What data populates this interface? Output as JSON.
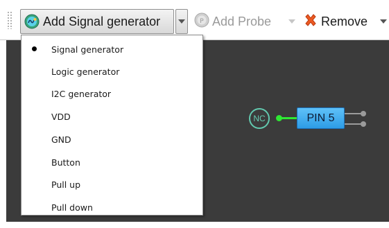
{
  "toolbar": {
    "add_signal_label": "Add Signal generator",
    "add_probe_label": "Add Probe",
    "remove_label": "Remove"
  },
  "menu": {
    "items": [
      {
        "label": "Signal generator",
        "selected": true
      },
      {
        "label": "Logic generator",
        "selected": false
      },
      {
        "label": "I2C generator",
        "selected": false
      },
      {
        "label": "VDD",
        "selected": false
      },
      {
        "label": "GND",
        "selected": false
      },
      {
        "label": "Button",
        "selected": false
      },
      {
        "label": "Pull up",
        "selected": false
      },
      {
        "label": "Pull down",
        "selected": false
      }
    ]
  },
  "canvas": {
    "nc_label": "NC",
    "pin_label": "PIN 5"
  },
  "colors": {
    "canvas_bg": "#3b3b3b",
    "wire": "#2ee833",
    "pin_fill": "#3fadf0",
    "nc_ring": "#62c9ae",
    "remove_icon": "#e8541c"
  },
  "icons": {
    "add_signal": "signal-generator-icon",
    "add_probe": "probe-icon",
    "remove": "remove-x-icon"
  }
}
